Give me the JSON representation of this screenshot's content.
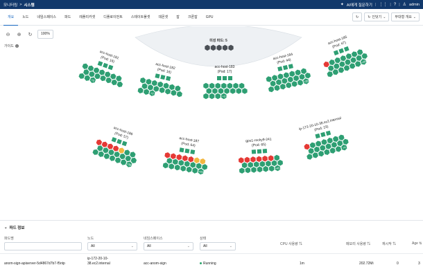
{
  "topbar": {
    "crumb_root": "모니터링",
    "crumb_sep": ">",
    "crumb_current": "시스템",
    "ai_label": "AI에게 질문하기",
    "user_label": "admin"
  },
  "tabs": [
    "개요",
    "노드",
    "네임스페이스",
    "파드",
    "레플리카셋",
    "디플로이먼트",
    "스테이트풀셋",
    "데몬셋",
    "잡",
    "크론잡",
    "GPU"
  ],
  "tools": {
    "expand_label": "인덧기",
    "layout_label": "무대형 개요"
  },
  "zoom": {
    "value": "100%"
  },
  "guide_label": "가이드",
  "pending": {
    "label": "미성 파드: 5",
    "count": 5
  },
  "colors": {
    "green": "#2e9f73",
    "red": "#e53935",
    "orange": "#f2b740",
    "gray": "#4a4f55",
    "navy": "#11386b",
    "accent": "#1565c0"
  },
  "hosts": [
    {
      "name": "acc-host-181",
      "pods": "(Pod: 16)",
      "badge": "+3",
      "red": 0,
      "orange": 0,
      "green": 16
    },
    {
      "name": "acc-host-182",
      "pods": "(Pod: 16)",
      "badge": "+3",
      "red": 0,
      "orange": 0,
      "green": 16
    },
    {
      "name": "acc-host-183",
      "pods": "(Pod: 17)",
      "badge": "+3",
      "red": 0,
      "orange": 0,
      "green": 17
    },
    {
      "name": "acc-host-184",
      "pods": "(Pod: 44)",
      "badge": "+28",
      "red": 0,
      "orange": 0,
      "green": 44
    },
    {
      "name": "acc-host-185",
      "pods": "(Pod: 47)",
      "badge": "+28",
      "red": 1,
      "orange": 0,
      "green": 46
    },
    {
      "name": "acc-host-186",
      "pods": "(Pod: 57)",
      "badge": "+38",
      "red": 4,
      "orange": 1,
      "green": 52
    },
    {
      "name": "acc-host-187",
      "pods": "(Pod: 64)",
      "badge": "+44",
      "red": 5,
      "orange": 2,
      "green": 57
    },
    {
      "name": "gpu1-rocky9-241",
      "pods": "(Pod: 65)",
      "badge": "+45",
      "red": 6,
      "orange": 0,
      "green": 59
    },
    {
      "name": "ip-172-20-10-38.ec2.internal",
      "pods": "(Pod: 23)",
      "badge": "+4",
      "red": 1,
      "orange": 0,
      "green": 22
    }
  ],
  "panel": {
    "title": "파드 정보",
    "headers": {
      "pod": "파드명",
      "node": "노드",
      "namespace": "네임스페이스",
      "status": "상태",
      "cpu": "CPU 사용량 ⇅",
      "mem": "메모리 사용량 ⇅",
      "restart": "재시작 ⇅",
      "age": "Age ⇅"
    },
    "filters": {
      "node": "All",
      "namespace": "All",
      "status": "All"
    },
    "row": {
      "pod": "anom-sign-apiserver-5d4867d7b7-f5ntp",
      "node": "ip-172-20-10-38.ec2.internal",
      "namespace": "acc-anom-sign",
      "status": "Running",
      "cpu": "1m",
      "mem": "202.72Mi",
      "restart": "0",
      "age": "3"
    }
  }
}
